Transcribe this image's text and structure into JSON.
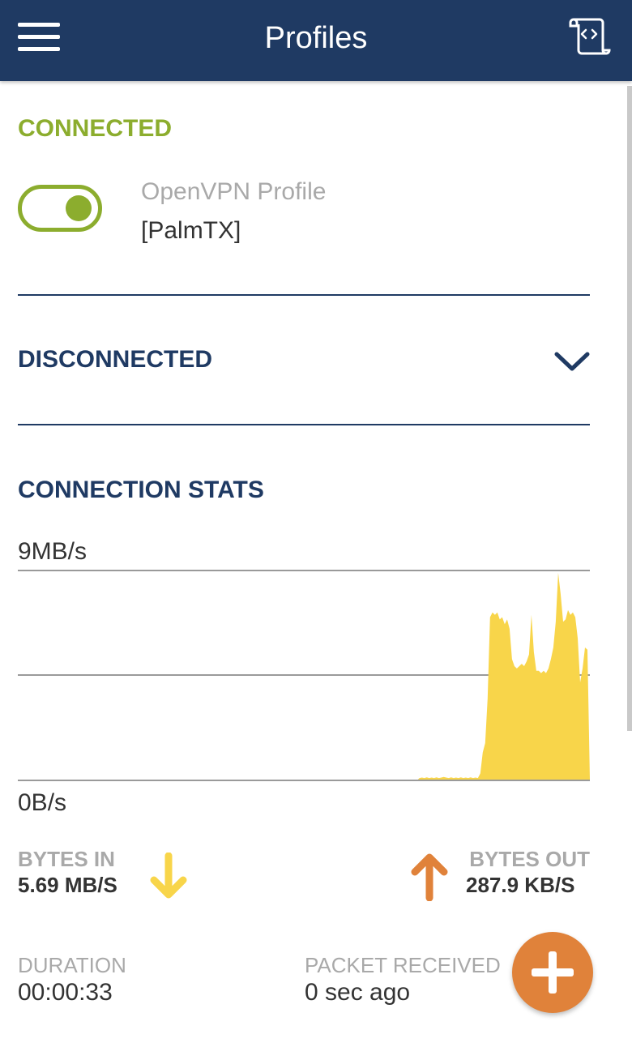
{
  "appbar": {
    "title": "Profiles"
  },
  "connected_section": {
    "label": "CONNECTED",
    "profile_type": "OpenVPN Profile",
    "profile_name": "[PalmTX]",
    "toggle_on": true
  },
  "disconnected_section": {
    "label": "DISCONNECTED"
  },
  "stats": {
    "label": "CONNECTION STATS",
    "bytes_in_label": "BYTES IN",
    "bytes_in_value": "5.69 MB/S",
    "bytes_out_label": "BYTES OUT",
    "bytes_out_value": "287.9 KB/S",
    "duration_label": "DURATION",
    "duration_value": "00:00:33",
    "packet_label": "PACKET RECEIVED",
    "packet_value": "0 sec ago"
  },
  "chart_data": {
    "type": "area",
    "ytick_labels": [
      "9MB/s",
      "0B/s"
    ],
    "ylim": [
      0,
      9
    ],
    "grid": true,
    "series": [
      {
        "color": "#f8d54a",
        "values": [
          0,
          0,
          0,
          0,
          0,
          0,
          0,
          0,
          0,
          0,
          0,
          0,
          0,
          0,
          0,
          0,
          0,
          0,
          0,
          0,
          0,
          0,
          0,
          0,
          0,
          0,
          0,
          0,
          0,
          0,
          0,
          0,
          0,
          0,
          0,
          0,
          0,
          0,
          0,
          0,
          0,
          0,
          0,
          0,
          0,
          0,
          0,
          0,
          0,
          0,
          0,
          0,
          0,
          0,
          0,
          0,
          0,
          0,
          0,
          0,
          0,
          0,
          0,
          0,
          0,
          0,
          0,
          0,
          0,
          0,
          0,
          0,
          0,
          0,
          0,
          0,
          0,
          0,
          0,
          0,
          0,
          0,
          0,
          0,
          0,
          0,
          0,
          0,
          0,
          0,
          0,
          0,
          0,
          0,
          0,
          0,
          0,
          0,
          0,
          0,
          0,
          0,
          0,
          0,
          0,
          0,
          0,
          0,
          0,
          0,
          0,
          0,
          0,
          0,
          0,
          0,
          0,
          0,
          0,
          0,
          0,
          0,
          0,
          0,
          0,
          0,
          0,
          0,
          0,
          0,
          0,
          0,
          0,
          0,
          0,
          0,
          0,
          0,
          0,
          0,
          0,
          0,
          0,
          0,
          0,
          0,
          0,
          0,
          0,
          0,
          0,
          0,
          0,
          0,
          0,
          0,
          0,
          0,
          0,
          0,
          0,
          0,
          0,
          0,
          0,
          0.1,
          0.12,
          0.1,
          0.13,
          0.1,
          0.12,
          0.1,
          0.13,
          0.1,
          0.12,
          0.15,
          0.12,
          0.1,
          0.13,
          0.1,
          0.12,
          0.1,
          0.13,
          0.1,
          0.12,
          0.1,
          0.13,
          0.1,
          0.12,
          0.1,
          0.3,
          1.2,
          1.6,
          3.5,
          7.0,
          7.2,
          7.1,
          7.2,
          6.9,
          7.0,
          6.7,
          6.9,
          6.5,
          5.2,
          4.9,
          4.8,
          4.9,
          5.0,
          4.9,
          5.1,
          5.4,
          7.1,
          5.5,
          4.7,
          4.7,
          4.6,
          4.7,
          4.6,
          4.8,
          5.2,
          5.7,
          6.8,
          8.9,
          8.0,
          6.8,
          6.9,
          7.3,
          7.1,
          7.2,
          7.0,
          6.1,
          4.2,
          4.8,
          5.7,
          5.6,
          0.0
        ]
      }
    ]
  }
}
